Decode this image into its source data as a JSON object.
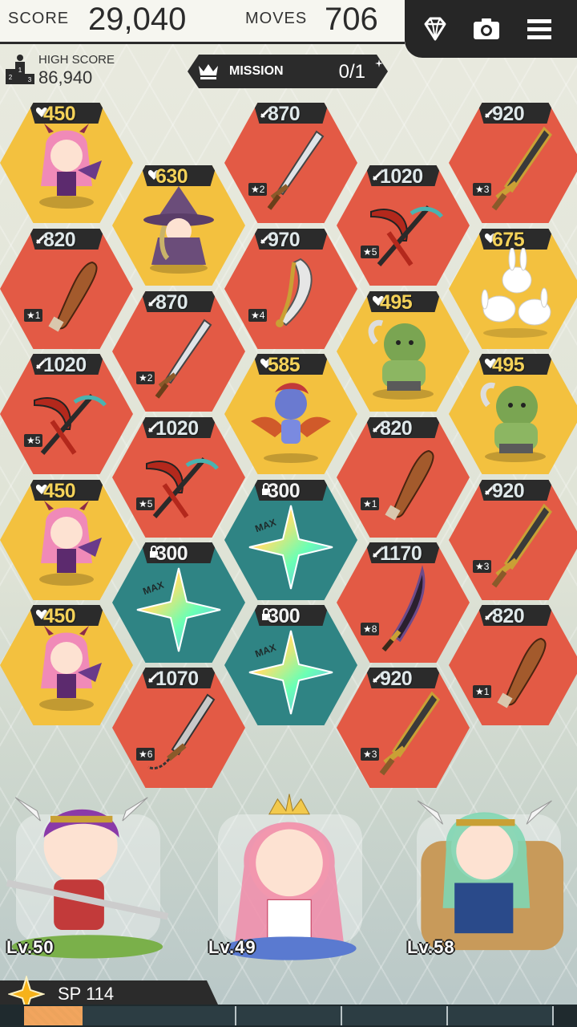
{
  "header": {
    "score_label": "SCORE",
    "score_value": "29,040",
    "moves_label": "MOVES",
    "moves_value": "706",
    "icons": [
      "gem-icon",
      "camera-icon",
      "menu-icon"
    ]
  },
  "high_score": {
    "label": "HIGH SCORE",
    "value": "86,940"
  },
  "mission": {
    "label": "MISSION",
    "progress": "0/1"
  },
  "tiles": [
    {
      "type": "monster",
      "color": "yellow",
      "value": "450",
      "art": "pink-demon-girl"
    },
    {
      "type": "monster",
      "color": "yellow",
      "value": "630",
      "art": "witch"
    },
    {
      "type": "weapon",
      "color": "red",
      "value": "870",
      "stars": "★2",
      "art": "sword"
    },
    {
      "type": "weapon",
      "color": "red",
      "value": "1020",
      "stars": "★5",
      "art": "scythe"
    },
    {
      "type": "weapon",
      "color": "red",
      "value": "920",
      "stars": "★3",
      "art": "golden-sword"
    },
    {
      "type": "weapon",
      "color": "red",
      "value": "820",
      "stars": "★1",
      "art": "club"
    },
    {
      "type": "weapon",
      "color": "red",
      "value": "870",
      "stars": "★2",
      "art": "sword"
    },
    {
      "type": "weapon",
      "color": "red",
      "value": "970",
      "stars": "★4",
      "art": "axe-blade"
    },
    {
      "type": "monster",
      "color": "yellow",
      "value": "495",
      "art": "orc"
    },
    {
      "type": "monster",
      "color": "yellow",
      "value": "675",
      "art": "rabbits"
    },
    {
      "type": "weapon",
      "color": "red",
      "value": "1020",
      "stars": "★5",
      "art": "scythe"
    },
    {
      "type": "weapon",
      "color": "red",
      "value": "1020",
      "stars": "★5",
      "art": "scythe"
    },
    {
      "type": "monster",
      "color": "yellow",
      "value": "585",
      "art": "harpy"
    },
    {
      "type": "weapon",
      "color": "red",
      "value": "820",
      "stars": "★1",
      "art": "club"
    },
    {
      "type": "monster",
      "color": "yellow",
      "value": "495",
      "art": "orc"
    },
    {
      "type": "monster",
      "color": "yellow",
      "value": "450",
      "art": "pink-demon-girl"
    },
    {
      "type": "locked",
      "color": "teal",
      "value": "300",
      "tag": "MAX",
      "art": "rainbow-star"
    },
    {
      "type": "locked",
      "color": "teal",
      "value": "300",
      "tag": "MAX",
      "art": "rainbow-star"
    },
    {
      "type": "weapon",
      "color": "red",
      "value": "1170",
      "stars": "★8",
      "art": "dark-blade"
    },
    {
      "type": "weapon",
      "color": "red",
      "value": "920",
      "stars": "★3",
      "art": "golden-sword"
    },
    {
      "type": "monster",
      "color": "yellow",
      "value": "450",
      "art": "pink-demon-girl"
    },
    {
      "type": "locked",
      "color": "teal",
      "value": "300",
      "tag": "MAX",
      "art": "rainbow-star"
    },
    {
      "type": "weapon",
      "color": "red",
      "value": "1070",
      "stars": "★6",
      "art": "chain-sword"
    },
    {
      "type": "weapon",
      "color": "red",
      "value": "920",
      "stars": "★3",
      "art": "golden-sword"
    },
    {
      "type": "weapon",
      "color": "red",
      "value": "820",
      "stars": "★1",
      "art": "club"
    }
  ],
  "heroes": [
    {
      "level": "Lv.50",
      "art": "purple-haired-warrior"
    },
    {
      "level": "Lv.49",
      "art": "pink-haired-princess"
    },
    {
      "level": "Lv.58",
      "art": "green-haired-valkyrie"
    }
  ],
  "sp": {
    "label": "SP 114",
    "fill_fraction": 0.11
  },
  "colors": {
    "red": "#e35a45",
    "yellow": "#f3c13f",
    "teal": "#2f8484",
    "dark": "#2b2b2b"
  }
}
